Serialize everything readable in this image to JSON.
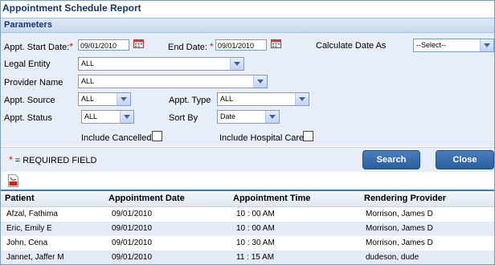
{
  "window": {
    "title": "Appointment Schedule Report"
  },
  "params": {
    "header": "Parameters"
  },
  "form": {
    "start_date_label": "Appt. Start Date:",
    "start_date_value": "09/01/2010",
    "end_date_label": "End Date:",
    "end_date_value": "09/01/2010",
    "calc_label": "Calculate Date As",
    "calc_value": "--Select--",
    "legal_entity_label": "Legal Entity",
    "legal_entity_value": "ALL",
    "provider_label": "Provider Name",
    "provider_value": "ALL",
    "source_label": "Appt. Source",
    "source_value": "ALL",
    "type_label": "Appt. Type",
    "type_value": "ALL",
    "status_label": "Appt. Status",
    "status_value": "ALL",
    "sort_label": "Sort By",
    "sort_value": "Date",
    "include_cancelled_label": "Include Cancelled",
    "include_hospital_label": "Include Hospital Care",
    "required_mark": "*",
    "required_note": "= REQUIRED FIELD"
  },
  "buttons": {
    "search": "Search",
    "close": "Close"
  },
  "table": {
    "headers": [
      "Patient",
      "Appointment Date",
      "Appointment Time",
      "Rendering Provider"
    ],
    "rows": [
      {
        "patient": "Afzal, Fathima",
        "date": "09/01/2010",
        "time": "10 : 00 AM",
        "provider": "Morrison, James D"
      },
      {
        "patient": "Eric, Emily E",
        "date": "09/01/2010",
        "time": "10 : 00 AM",
        "provider": "Morrison, James D"
      },
      {
        "patient": "John, Cena",
        "date": "09/01/2010",
        "time": "10 : 30 AM",
        "provider": "Morrison, James D"
      },
      {
        "patient": "Jannet, Jaffer M",
        "date": "09/01/2010",
        "time": "11 : 15 AM",
        "provider": "dudeson, dude"
      }
    ]
  },
  "colors": {
    "title": "#13357a",
    "button": "#2c5d9c",
    "row_alt": "#e4ebf5",
    "required": "#e01010"
  },
  "icons": {
    "calendar": "calendar-icon",
    "pdf": "pdf-icon"
  }
}
